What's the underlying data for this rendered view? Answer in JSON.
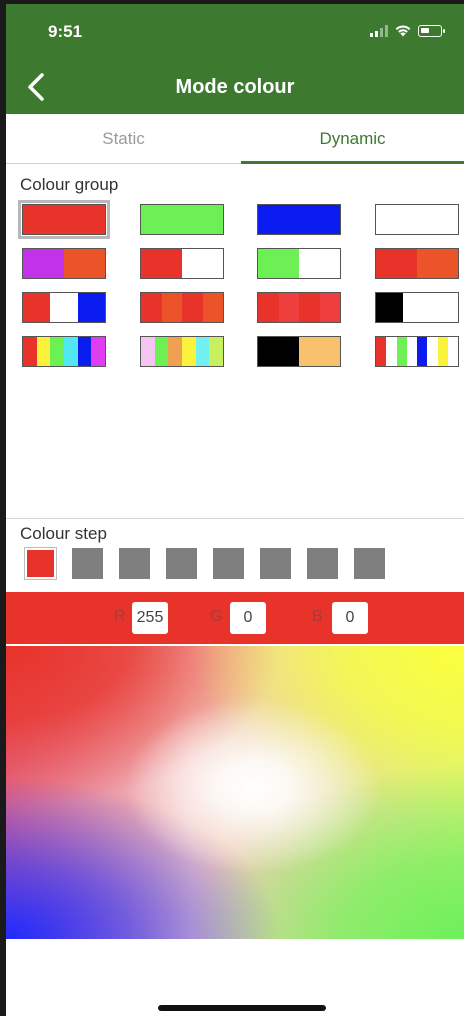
{
  "status_bar": {
    "time": "9:51"
  },
  "nav": {
    "title": "Mode colour"
  },
  "tabs": [
    {
      "label": "Static",
      "active": false
    },
    {
      "label": "Dynamic",
      "active": true
    }
  ],
  "colour_group": {
    "label": "Colour group",
    "swatches": [
      {
        "colors": [
          "#e8332a"
        ],
        "selected": true
      },
      {
        "colors": [
          "#6df054"
        ]
      },
      {
        "colors": [
          "#0a1cf0"
        ]
      },
      {
        "colors": [
          "#ffffff"
        ]
      },
      {
        "colors": [
          "#c132e8",
          "#ea5428"
        ]
      },
      {
        "colors": [
          "#e8332a",
          "#ffffff"
        ]
      },
      {
        "colors": [
          "#6df054",
          "#ffffff"
        ]
      },
      {
        "colors": [
          "#e8332a",
          "#ea5428"
        ]
      },
      {
        "colors": [
          "#e8332a",
          "#ffffff",
          "#0a1cf0"
        ]
      },
      {
        "colors": [
          "#e8332a",
          "#ea5428",
          "#e8332a",
          "#ea5428"
        ]
      },
      {
        "colors": [
          "#e8332a",
          "#ef3e3e",
          "#e8332a",
          "#ef3e3e"
        ]
      },
      {
        "colors": [
          "#000000",
          "#ffffff",
          "#ffffff"
        ]
      },
      {
        "colors": [
          "#e8332a",
          "#fbf23c",
          "#6df054",
          "#52e8f0",
          "#0a1cf0",
          "#e03cf0"
        ]
      },
      {
        "colors": [
          "#f4c4f2",
          "#6df054",
          "#f0a050",
          "#fbf23c",
          "#70f0f0",
          "#c6f060"
        ]
      },
      {
        "colors": [
          "#000000",
          "#000000",
          "#f7c16e",
          "#f7c16e"
        ]
      },
      {
        "colors": [
          "#e8332a",
          "#ffffff",
          "#6df054",
          "#ffffff",
          "#0a1cf0",
          "#ffffff",
          "#fbf23c",
          "#ffffff"
        ]
      }
    ]
  },
  "colour_step": {
    "label": "Colour step",
    "steps": [
      {
        "color": "#e8332a",
        "active": true
      },
      {
        "color": "#7f7f7f"
      },
      {
        "color": "#7f7f7f"
      },
      {
        "color": "#7f7f7f"
      },
      {
        "color": "#7f7f7f"
      },
      {
        "color": "#7f7f7f"
      },
      {
        "color": "#7f7f7f"
      },
      {
        "color": "#7f7f7f"
      }
    ]
  },
  "rgb": {
    "r_label": "R",
    "r_value": "255",
    "g_label": "G",
    "g_value": "0",
    "b_label": "B",
    "b_value": "0",
    "current_color": "#e8332a"
  },
  "colors": {
    "accent": "#3d7a2f"
  }
}
